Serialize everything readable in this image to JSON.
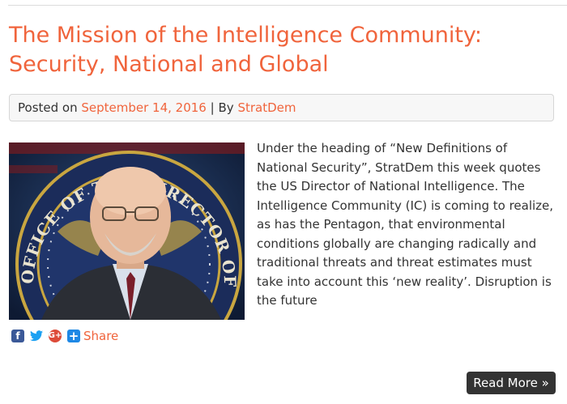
{
  "post": {
    "title": "The Mission of the Intelligence Community: Security, National and Global",
    "meta": {
      "posted_on_label": "Posted on",
      "date": "September 14, 2016",
      "separator": "|",
      "by_label": "By",
      "author": "StratDem"
    },
    "excerpt": "Under the heading of “New Definitions of National Security”, StratDem this week quotes the US Director of National Intelligence. The Intelligence Community (IC) is coming to realize, as has the Pentagon, that environmental conditions globally are changing radically and traditional threats and threat estimates must take into account this ‘new reality’. Disruption is the future",
    "image": {
      "seal_text": "OFFICE OF THE DIRECTOR OF NATIONAL INTELLIGENCE"
    },
    "share": {
      "facebook_icon": "facebook-icon",
      "twitter_icon": "twitter-icon",
      "googleplus_icon": "google-plus-icon",
      "share_icon": "plus-icon",
      "label": "Share"
    },
    "read_more_label": "Read More »"
  },
  "colors": {
    "accent": "#f0643c",
    "button_bg": "#333333",
    "meta_bg": "#f7f7f7"
  }
}
